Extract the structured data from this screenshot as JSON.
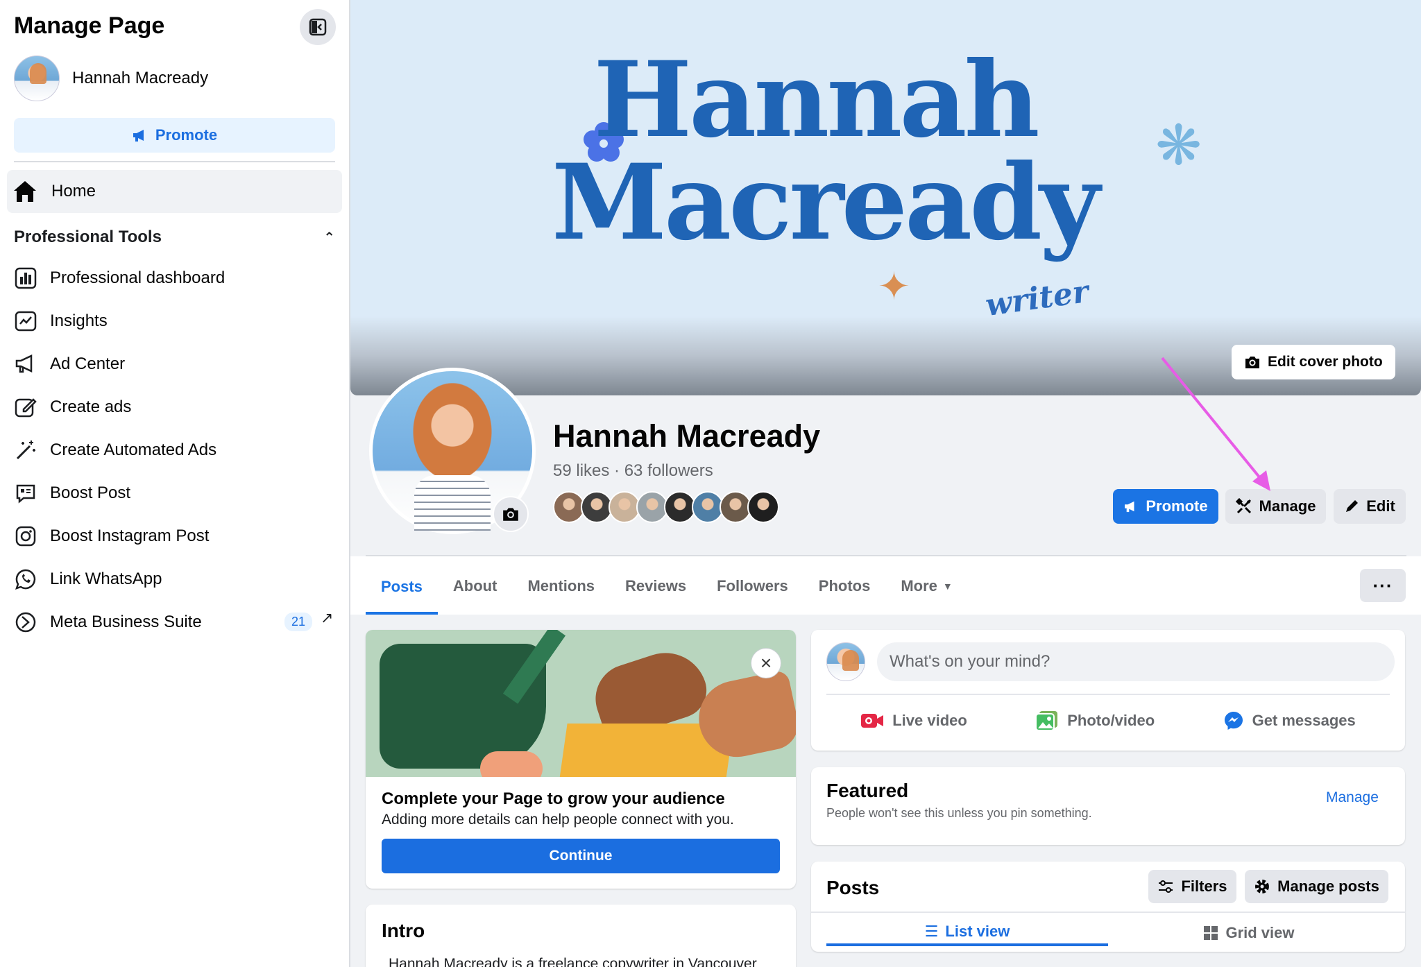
{
  "sidebar": {
    "title": "Manage Page",
    "profile_name": "Hannah Macready",
    "promote_label": "Promote",
    "home_label": "Home",
    "section_title": "Professional Tools",
    "items": [
      {
        "label": "Professional dashboard",
        "icon": "dashboard-icon"
      },
      {
        "label": "Insights",
        "icon": "insights-icon"
      },
      {
        "label": "Ad Center",
        "icon": "megaphone-icon"
      },
      {
        "label": "Create ads",
        "icon": "edit-square-icon"
      },
      {
        "label": "Create Automated Ads",
        "icon": "magic-wand-icon"
      },
      {
        "label": "Boost Post",
        "icon": "boost-post-icon"
      },
      {
        "label": "Boost Instagram Post",
        "icon": "instagram-icon"
      },
      {
        "label": "Link WhatsApp",
        "icon": "whatsapp-icon"
      },
      {
        "label": "Meta Business Suite",
        "icon": "meta-business-suite-icon",
        "badge": "21"
      }
    ]
  },
  "cover": {
    "title_line1": "Hannah",
    "title_line2": "Macready",
    "subtitle": "writer",
    "edit_cover_label": "Edit cover photo"
  },
  "profile": {
    "name": "Hannah Macready",
    "stats": "59 likes · 63 followers",
    "friend_colors": [
      "#8a6a55",
      "#3d3d3d",
      "#c9b29a",
      "#9aa3a8",
      "#2b2b2b",
      "#4f7fa6",
      "#6b5a4a",
      "#1f1f1f"
    ]
  },
  "actions": {
    "promote": "Promote",
    "manage": "Manage",
    "edit": "Edit"
  },
  "tabs": [
    {
      "label": "Posts",
      "active": true
    },
    {
      "label": "About"
    },
    {
      "label": "Mentions"
    },
    {
      "label": "Reviews"
    },
    {
      "label": "Followers"
    },
    {
      "label": "Photos"
    },
    {
      "label": "More"
    }
  ],
  "complete_card": {
    "title": "Complete your Page to grow your audience",
    "subtitle": "Adding more details can help people connect with you.",
    "button": "Continue"
  },
  "intro": {
    "title": "Intro",
    "text": "Hannah Macready is a freelance copywriter in Vancouver"
  },
  "composer": {
    "placeholder": "What's on your mind?",
    "actions": [
      "Live video",
      "Photo/video",
      "Get messages"
    ]
  },
  "featured": {
    "title": "Featured",
    "subtitle": "People won't see this unless you pin something.",
    "manage": "Manage"
  },
  "posts": {
    "title": "Posts",
    "filters": "Filters",
    "manage_posts": "Manage posts",
    "list_view": "List view",
    "grid_view": "Grid view"
  },
  "colors": {
    "accent": "#1b74e4",
    "annotation_arrow": "#e75ce6"
  }
}
